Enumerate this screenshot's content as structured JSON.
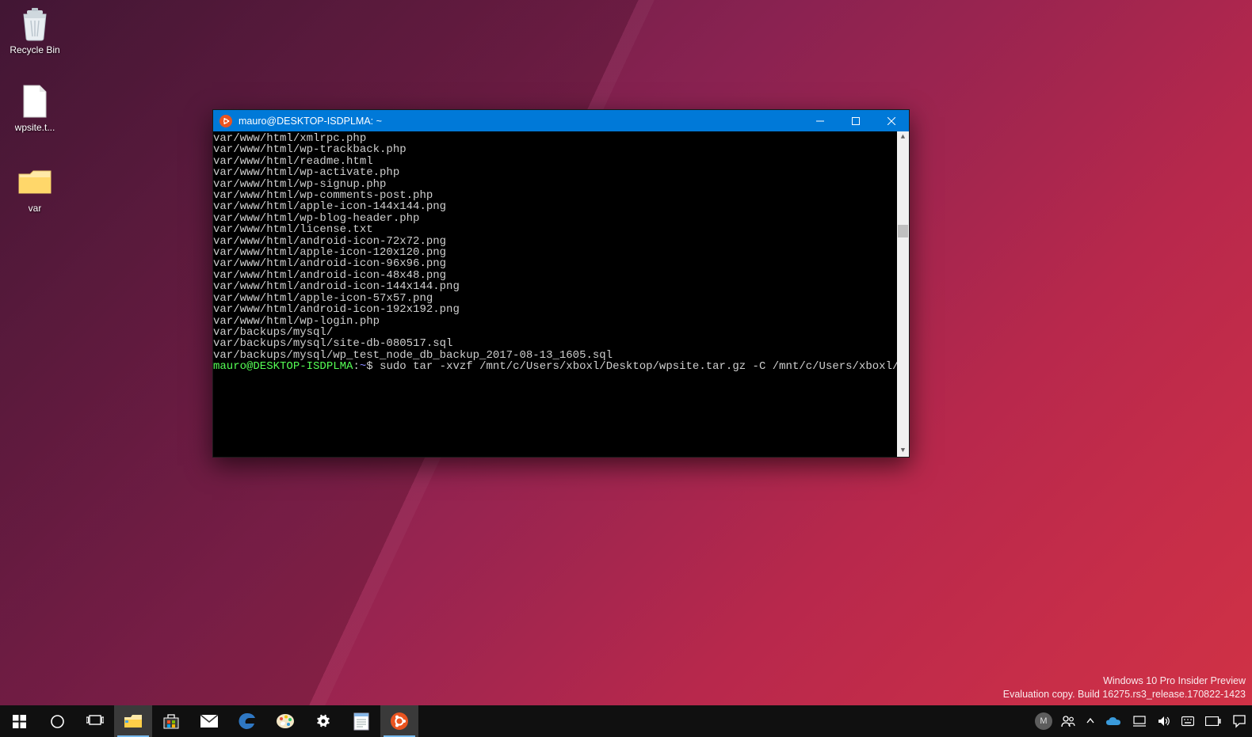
{
  "desktop_icons": {
    "recycle_bin": {
      "label": "Recycle Bin"
    },
    "wpsite_file": {
      "label": "wpsite.t..."
    },
    "var_folder": {
      "label": "var"
    }
  },
  "window": {
    "title": "mauro@DESKTOP-ISDPLMA: ~",
    "app_icon": "ubuntu-icon"
  },
  "terminal": {
    "output_lines": [
      "var/www/html/xmlrpc.php",
      "var/www/html/wp-trackback.php",
      "var/www/html/readme.html",
      "var/www/html/wp-activate.php",
      "var/www/html/wp-signup.php",
      "var/www/html/wp-comments-post.php",
      "var/www/html/apple-icon-144x144.png",
      "var/www/html/wp-blog-header.php",
      "var/www/html/license.txt",
      "var/www/html/android-icon-72x72.png",
      "var/www/html/apple-icon-120x120.png",
      "var/www/html/android-icon-96x96.png",
      "var/www/html/android-icon-48x48.png",
      "var/www/html/android-icon-144x144.png",
      "var/www/html/apple-icon-57x57.png",
      "var/www/html/android-icon-192x192.png",
      "var/www/html/wp-login.php",
      "var/backups/mysql/",
      "var/backups/mysql/site-db-080517.sql",
      "var/backups/mysql/wp_test_node_db_backup_2017-08-13_1605.sql"
    ],
    "prompt": {
      "user_host": "mauro@DESKTOP-ISDPLMA",
      "separator": ":",
      "path": "~",
      "dollar": "$",
      "command": "sudo tar -xvzf /mnt/c/Users/xboxl/Desktop/wpsite.tar.gz -C /mnt/c/Users/xboxl/Desktop/"
    }
  },
  "watermark": {
    "line1": "Windows 10 Pro Insider Preview",
    "line2": "Evaluation copy. Build 16275.rs3_release.170822-1423"
  },
  "taskbar": {
    "start": "Start",
    "cortana": "Cortana",
    "taskview": "Task View",
    "explorer": "File Explorer",
    "store": "Microsoft Store",
    "mail": "Mail",
    "edge": "Microsoft Edge",
    "paint": "Paint",
    "settings": "Settings",
    "notepad": "Notepad",
    "ubuntu": "Ubuntu"
  },
  "tray": {
    "user_initial": "M",
    "people": "People",
    "show_hidden": "Show hidden icons",
    "onedrive": "OneDrive",
    "network": "Network",
    "volume": "Volume",
    "ime": "Input",
    "battery": "Battery",
    "action_center": "Action Center"
  },
  "colors": {
    "titlebar": "#0079d8",
    "ubuntu": "#e95420",
    "terminal_bg": "#000000",
    "terminal_fg": "#cfcfcf",
    "prompt_green": "#55ff55",
    "prompt_blue": "#8888ff",
    "taskbar": "#101010"
  }
}
